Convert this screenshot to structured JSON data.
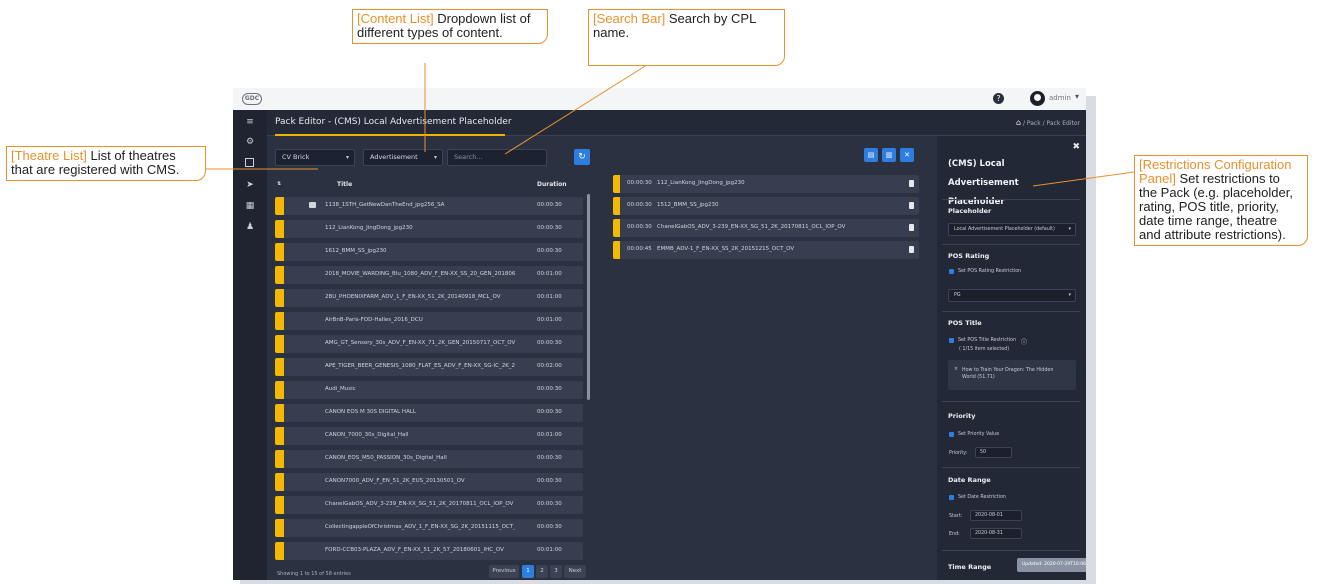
{
  "callouts": {
    "content_list": {
      "tag": "[Content List]",
      "text": " Dropdown list of different types of content."
    },
    "search_bar": {
      "tag": "[Search Bar]",
      "text": " Search by CPL name."
    },
    "theatre_list": {
      "tag": "[Theatre List]",
      "text": " List of theatres that are registered with CMS."
    },
    "restrictions": {
      "tag": "[Restrictions Configuration Panel]",
      "text": " Set restrictions to the Pack (e.g. placeholder, rating, POS title, priority, date time range, theatre and attribute restrictions)."
    }
  },
  "header": {
    "logo_text": "GDC",
    "user_name": "admin"
  },
  "page": {
    "title": "Pack Editor - (CMS) Local Advertisement Placeholder",
    "breadcrumb": "/ Pack / Pack Editor"
  },
  "filters": {
    "theatre": "CV Brick",
    "content_type": "Advertisement",
    "search_placeholder": "Search..."
  },
  "content_table": {
    "headers": {
      "title": "Title",
      "duration": "Duration"
    },
    "rows": [
      {
        "name": "1138_1STH_GetNewDanTheEnd_jpg256_SA",
        "duration": "00:00:30"
      },
      {
        "name": "112_LianKong_JingDong_jpg230",
        "duration": "00:00:30"
      },
      {
        "name": "1612_BMM_SS_jpg230",
        "duration": "00:00:30"
      },
      {
        "name": "2018_MOVIE_WARDING_Blu_1080_ADV_F_EN-XX_SS_20_GEN_20180625_ENG",
        "duration": "00:01:00"
      },
      {
        "name": "2BU_PHOENIXFARM_ADV_1_F_EN-XX_51_2K_20140918_MCL_OV",
        "duration": "00:01:00"
      },
      {
        "name": "AirBnB-Paris-FOD-Halles_2016_DCU",
        "duration": "00:01:00"
      },
      {
        "name": "AMG_GT_Sensory_30s_ADV_F_EN-XX_71_2K_GEN_20150717_OCT_OV",
        "duration": "00:00:30"
      },
      {
        "name": "APE_TIGER_BEER_GENESIS_1080_FLAT_ES_ADV_F_EN-XX_SG-IC_2K_20130920",
        "duration": "00:02:00"
      },
      {
        "name": "Audi_Music",
        "duration": "00:00:30"
      },
      {
        "name": "CANON EOS M 30S DIGITAL HALL",
        "duration": "00:00:30"
      },
      {
        "name": "CANON_7000_30s_Digital_Hall",
        "duration": "00:01:00"
      },
      {
        "name": "CANON_EOS_M50_PASSION_30s_Digital_Hall",
        "duration": "00:00:30"
      },
      {
        "name": "CANON7000_ADV_F_EN_51_2K_EUS_20130501_OV",
        "duration": "00:00:30"
      },
      {
        "name": "ChanelGabOS_ADV_3-239_EN-XX_SG_51_2K_20170811_OCL_IOP_OV",
        "duration": "00:00:30"
      },
      {
        "name": "CollectingappleOfChristmas_ADV_1_F_EN-XX_SG_2K_20151115_OCT_OV",
        "duration": "00:00:30"
      },
      {
        "name": "FORD-CCB03-PLAZA_ADV_F_EN-XX_51_2K_57_20180601_IHC_OV",
        "duration": "00:01:00"
      }
    ],
    "footer": "Showing 1 to 15 of 58 entries",
    "pagination": {
      "previous": "Previous",
      "pages": [
        "1",
        "2",
        "3"
      ],
      "next": "Next"
    }
  },
  "pack_items": [
    {
      "time": "00:00:30",
      "name": "112_LianKong_JingDong_jpg230"
    },
    {
      "time": "00:00:30",
      "name": "1512_BMM_SS_jpg230"
    },
    {
      "time": "00:00:30",
      "name": "ChanelGabOS_ADV_3-239_EN-XX_SG_51_2K_20170811_OCL_IOP_OV"
    },
    {
      "time": "00:00:45",
      "name": "EMMB_ADV-1_F_EN-XX_SS_2K_20151215_OCT_OV"
    }
  ],
  "restrictions": {
    "title": "(CMS) Local Advertisement Placeholder",
    "placeholder": {
      "heading": "Placeholder",
      "value": "Local Advertisement Placeholder (default)"
    },
    "pos_rating": {
      "heading": "POS Rating",
      "checkbox": "Set POS Rating Restriction",
      "value": "PG"
    },
    "pos_title": {
      "heading": "POS Title",
      "checkbox": "Set POS Title Restriction",
      "selected": "( 1/15 item selected)",
      "item": "How to Train Your Dragon: The Hidden World (51.71)"
    },
    "priority": {
      "heading": "Priority",
      "checkbox": "Set Priority Value",
      "label": "Priority:",
      "value": "50"
    },
    "date_range": {
      "heading": "Date Range",
      "checkbox": "Set Date Restriction",
      "start_label": "Start:",
      "start": "2020-08-01",
      "end_label": "End:",
      "end": "2020-08-31"
    },
    "time_range": {
      "heading": "Time Range"
    },
    "toast": "Updated: 2020-07-29T16:06:27"
  }
}
